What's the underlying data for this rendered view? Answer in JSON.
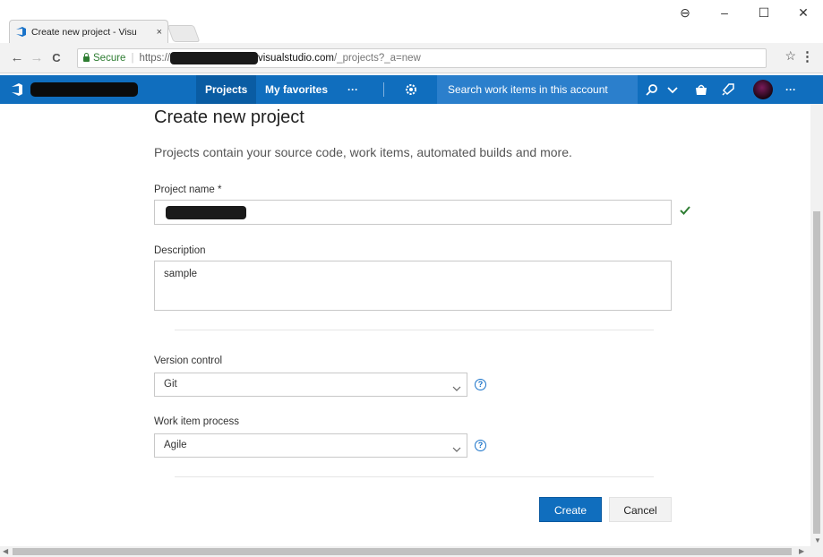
{
  "browser": {
    "tab_title": "Create new project - Visu",
    "tab_close": "×",
    "window_controls": [
      "⊖",
      "–",
      "☐",
      "✕"
    ],
    "nav": {
      "back": "←",
      "forward": "→",
      "reload": "C"
    },
    "secure_label": "Secure",
    "url_prefix": "https://",
    "url_host": "visualstudio.com",
    "url_path": "/_projects?_a=new",
    "star": "☆",
    "menu": "⋮"
  },
  "appbar": {
    "nav": [
      "Projects",
      "My favorites",
      "···"
    ],
    "search_placeholder": "Search work items in this account",
    "more": "···",
    "icons": [
      "vsts-logo-icon",
      "gear-icon",
      "search-icon",
      "chevron-down-icon",
      "bag-icon",
      "rocket-icon"
    ]
  },
  "form": {
    "title": "Create new project",
    "subtitle": "Projects contain your source code, work items, automated builds and more.",
    "project_name_label": "Project name *",
    "description_label": "Description",
    "description_value": "sample",
    "version_control_label": "Version control",
    "version_control_value": "Git",
    "process_label": "Work item process",
    "process_value": "Agile",
    "help_glyph": "?",
    "create_label": "Create",
    "cancel_label": "Cancel"
  },
  "colors": {
    "accent": "#106ebe",
    "search_bg": "#2b7fcc",
    "valid_check": "#2e7d32"
  }
}
